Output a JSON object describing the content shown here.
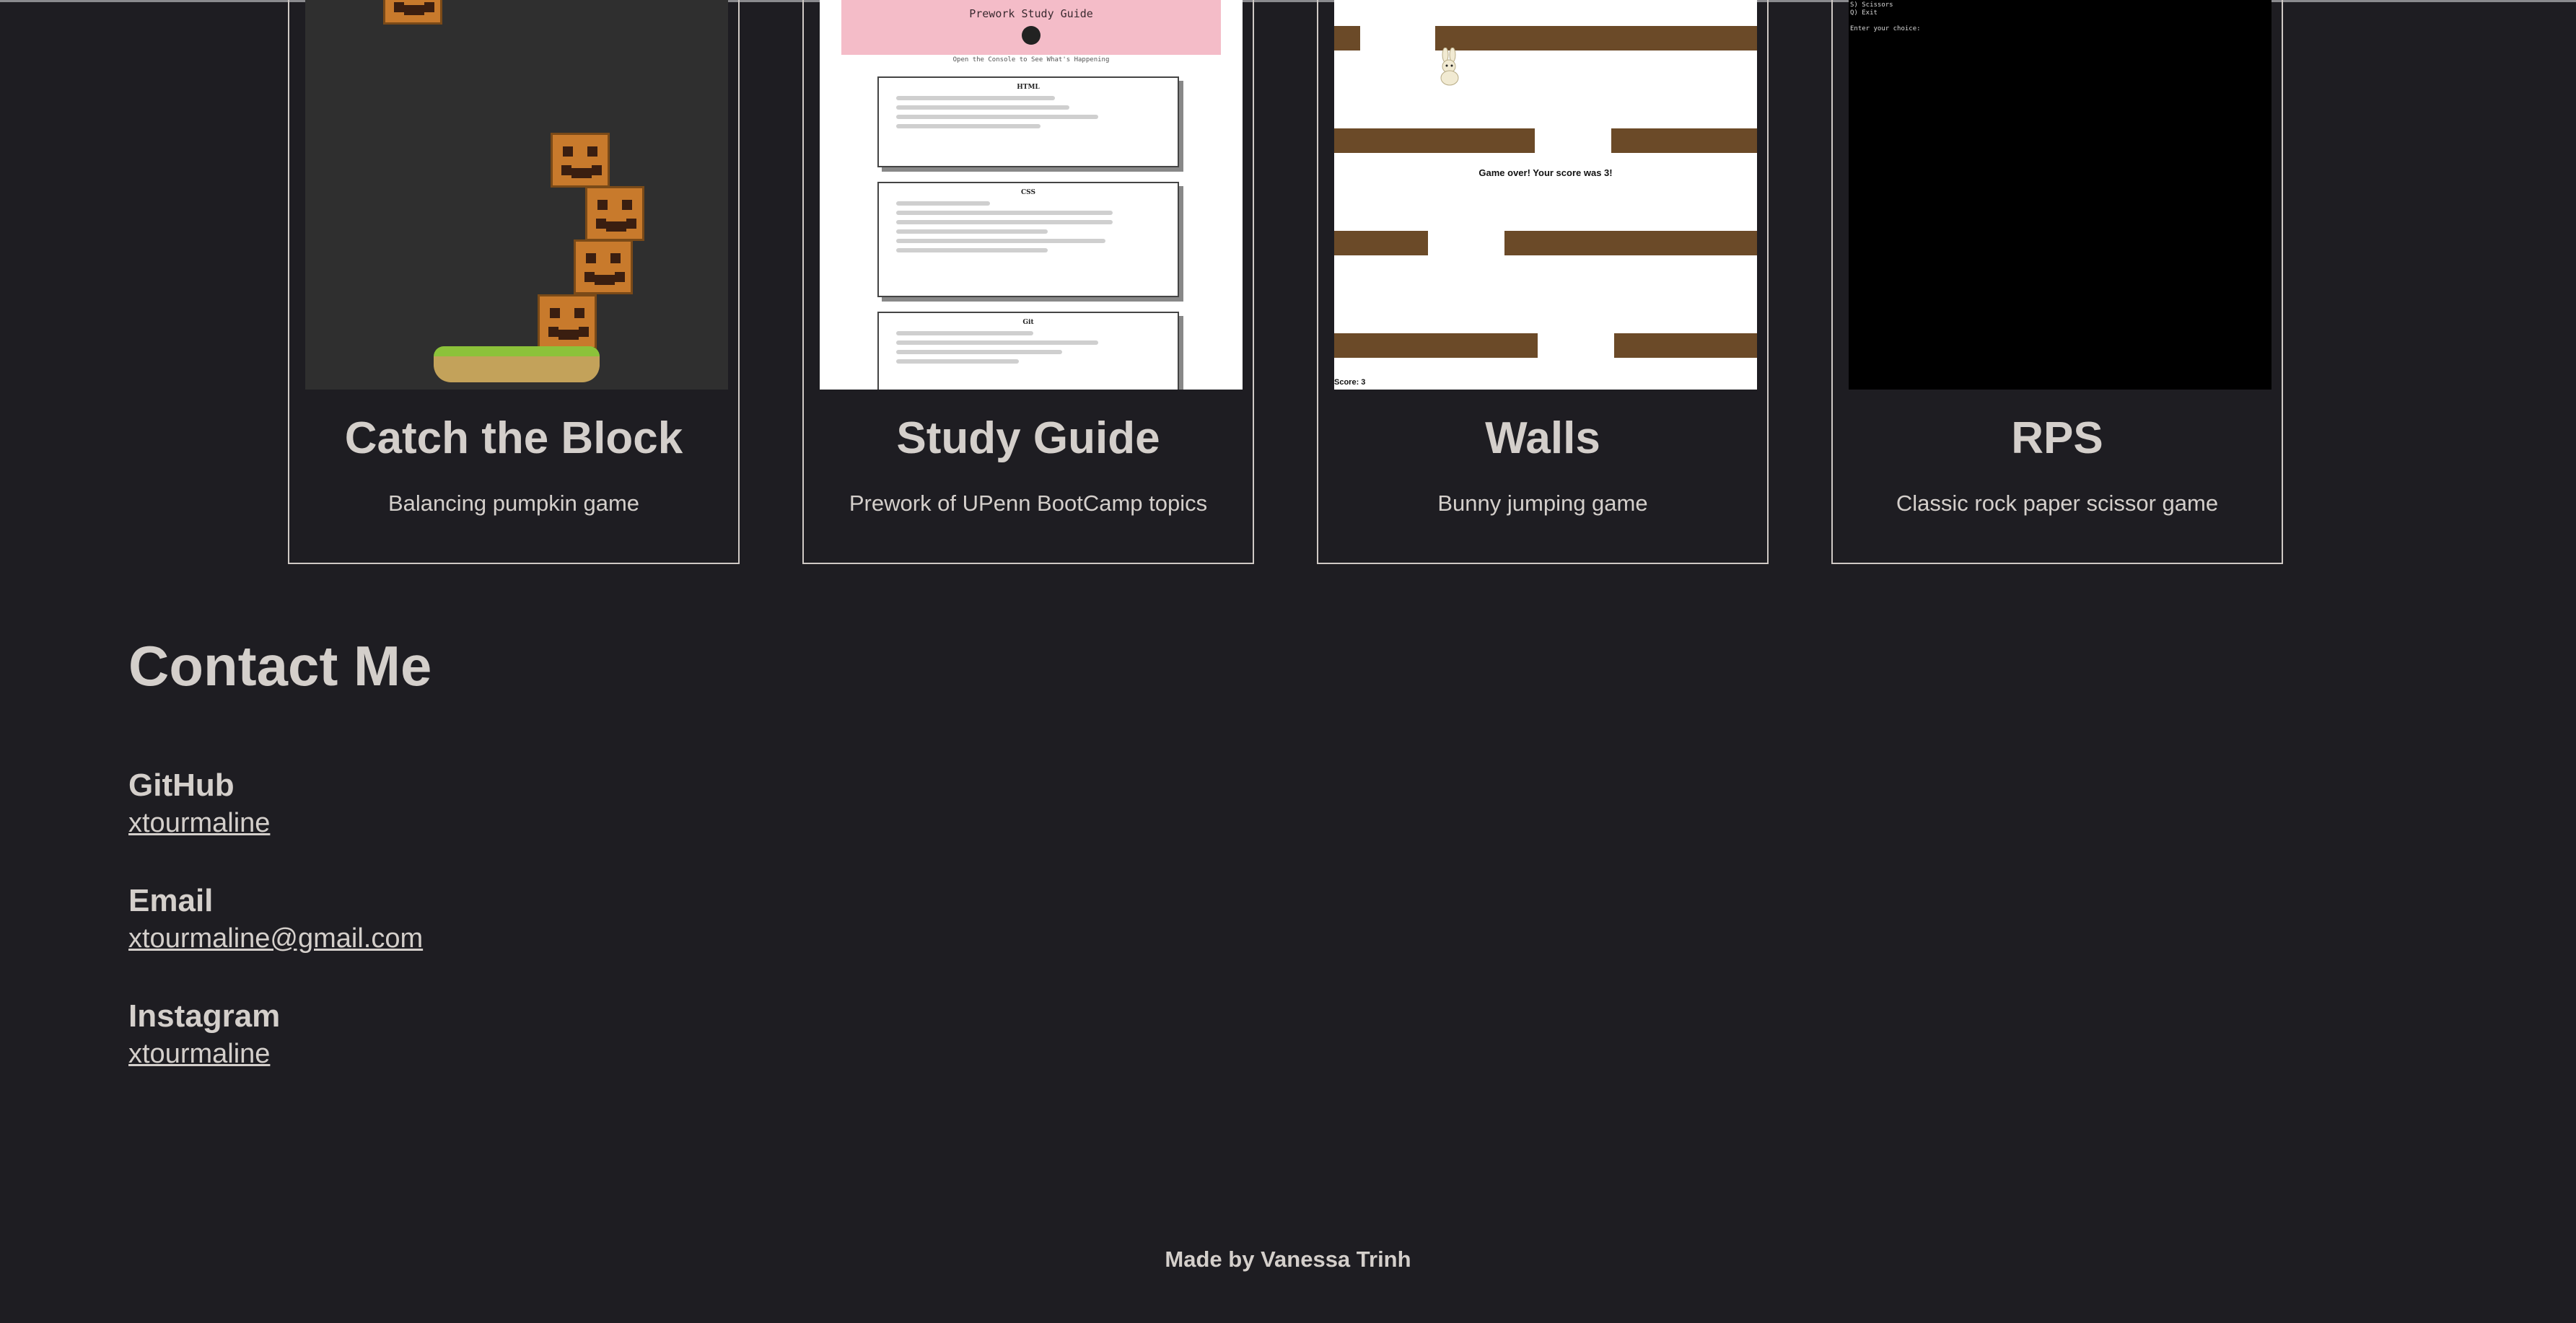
{
  "projects": [
    {
      "title": "Catch the Block",
      "description": "Balancing pumpkin game"
    },
    {
      "title": "Study Guide",
      "description": "Prework of UPenn BootCamp topics"
    },
    {
      "title": "Walls",
      "description": "Bunny jumping game"
    },
    {
      "title": "RPS",
      "description": "Classic rock paper scissor game"
    }
  ],
  "screens": {
    "study": {
      "header": "Prework Study Guide",
      "note": "Open the Console to See What's Happening",
      "sections": [
        "HTML",
        "CSS",
        "Git"
      ]
    },
    "walls": {
      "message": "Game over! Your score was 3!",
      "score": "Score: 3"
    },
    "rps": {
      "lines": [
        "S) Scissors",
        "Q) Exit",
        "Enter your choice:"
      ]
    }
  },
  "contact": {
    "heading": "Contact Me",
    "items": [
      {
        "label": "GitHub",
        "value": "xtourmaline"
      },
      {
        "label": "Email",
        "value": "xtourmaline@gmail.com"
      },
      {
        "label": "Instagram",
        "value": "xtourmaline"
      }
    ]
  },
  "footer": "Made by Vanessa Trinh",
  "colors": {
    "background": "#1e1d22",
    "text": "#d4cfcb",
    "study_header": "#f4bcc8",
    "wall": "#6b4a28"
  }
}
